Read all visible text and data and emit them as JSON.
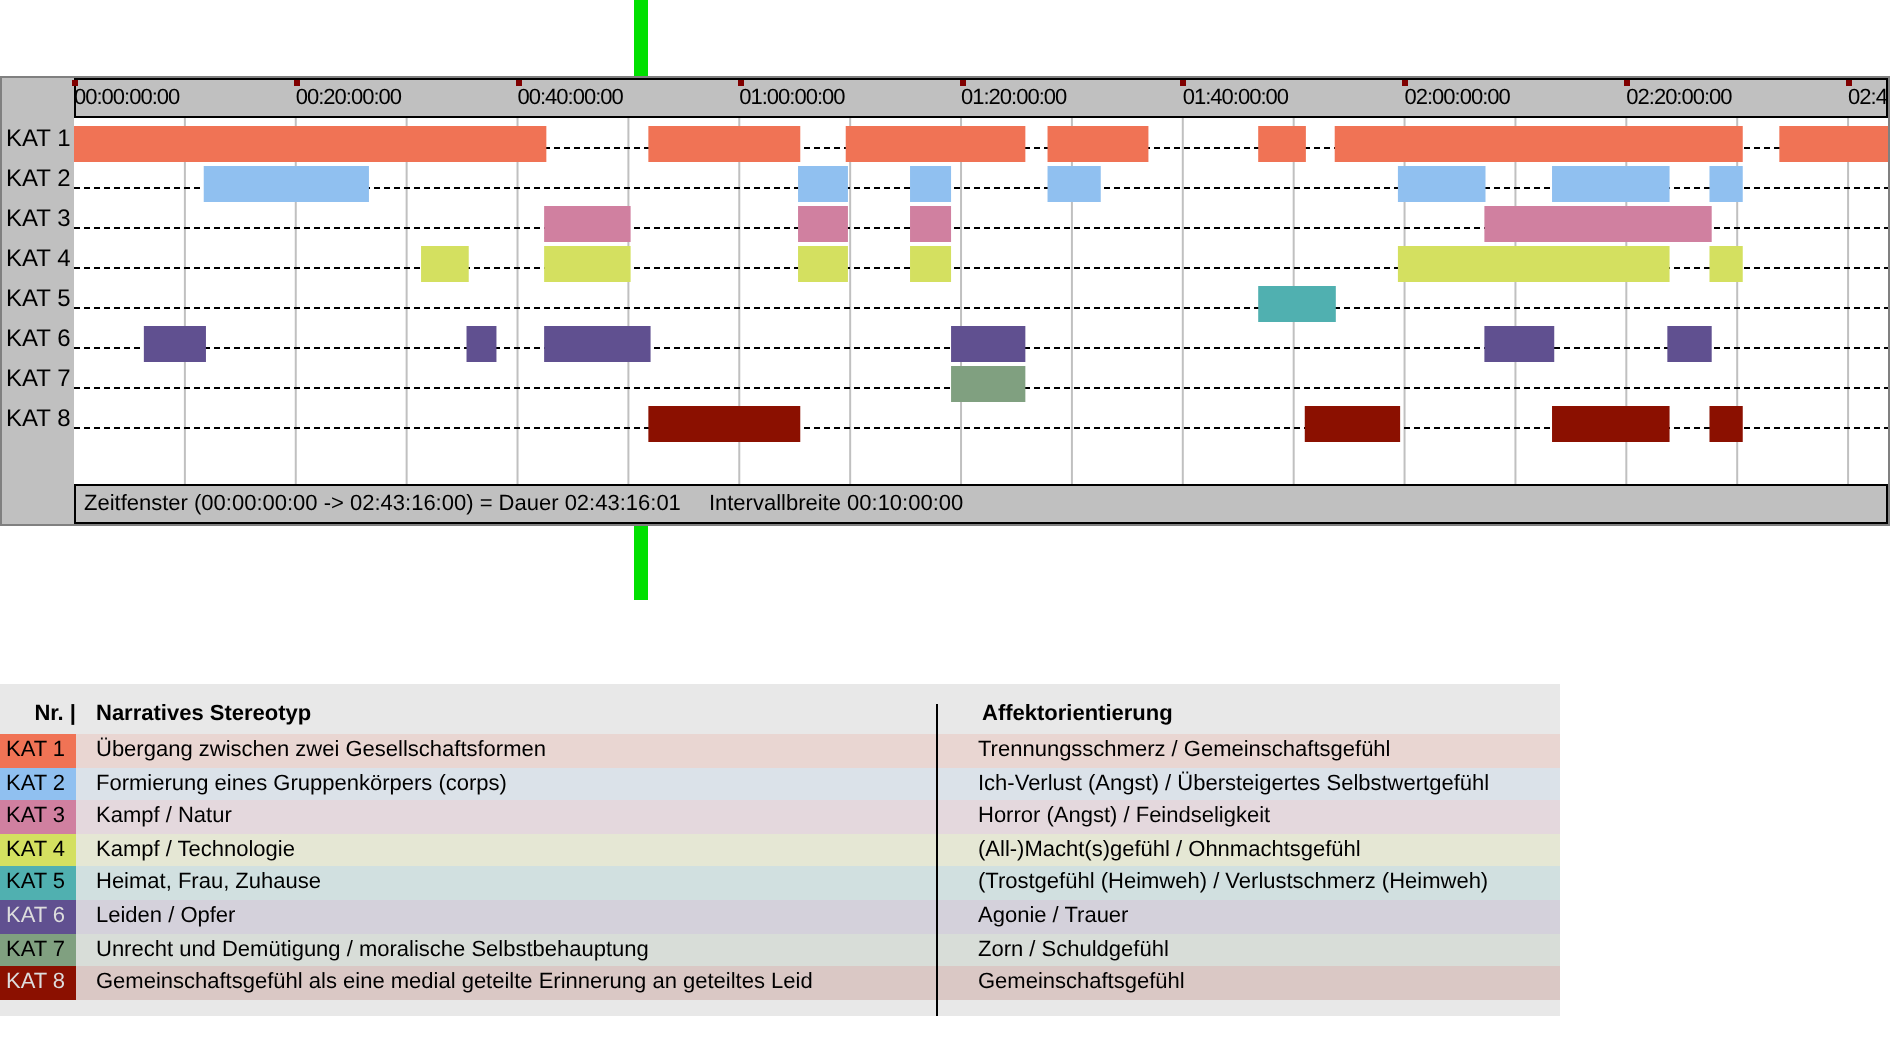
{
  "timeline": {
    "ruler": [
      "00:00:00:00",
      "00:20:00:00",
      "00:40:00:00",
      "01:00:00:00",
      "01:20:00:00",
      "01:40:00:00",
      "02:00:00:00",
      "02:20:00:00",
      "02:4"
    ],
    "tracks": [
      {
        "label": "KAT 1",
        "color": "#f07355"
      },
      {
        "label": "KAT 2",
        "color": "#90c0f0"
      },
      {
        "label": "KAT 3",
        "color": "#d080a0"
      },
      {
        "label": "KAT 4",
        "color": "#d4e060"
      },
      {
        "label": "KAT 5",
        "color": "#50b0b0"
      },
      {
        "label": "KAT 6",
        "color": "#605090"
      },
      {
        "label": "KAT 7",
        "color": "#80a080"
      },
      {
        "label": "KAT 8",
        "color": "#8b1000"
      }
    ],
    "status_bar": {
      "window": "Zeitfenster (00:00:00:00 -> 02:43:16:00) = Dauer 02:43:16:01",
      "interval": "Intervallbreite 00:10:00:00"
    }
  },
  "legend": {
    "columns": [
      "Nr. |",
      "Narratives Stereotyp",
      "Affektorientierung"
    ],
    "rows": [
      {
        "label": "KAT 1",
        "color": "#f07355",
        "stereotype": "Übergang zwischen zwei Gesellschaftsformen",
        "affect": "Trennungsschmerz / Gemeinschaftsgefühl"
      },
      {
        "label": "KAT 2",
        "color": "#90c0f0",
        "stereotype": "Formierung eines Gruppenkörpers (corps)",
        "affect": "Ich-Verlust (Angst) / Übersteigertes Selbstwertgefühl"
      },
      {
        "label": "KAT 3",
        "color": "#d080a0",
        "stereotype": "Kampf / Natur",
        "affect": "Horror (Angst) / Feindseligkeit"
      },
      {
        "label": "KAT 4",
        "color": "#d4e060",
        "stereotype": "Kampf / Technologie",
        "affect": "(All-)Macht(s)gefühl / Ohnmachtsgefühl"
      },
      {
        "label": "KAT 5",
        "color": "#50b0b0",
        "stereotype": "Heimat, Frau, Zuhause",
        "affect": "(Trostgefühl (Heimweh) / Verlustschmerz (Heimweh)"
      },
      {
        "label": "KAT 6",
        "color": "#605090",
        "stereotype": "Leiden / Opfer",
        "affect": "Agonie / Trauer"
      },
      {
        "label": "KAT 7",
        "color": "#80a080",
        "stereotype": "Unrecht und Demütigung / moralische Selbstbehauptung",
        "affect": "Zorn / Schuldgefühl"
      },
      {
        "label": "KAT 8",
        "color": "#8b1000",
        "stereotype": "Gemeinschaftsgefühl als eine medial geteilte Erinnerung an geteiltes Leid",
        "affect": "Gemeinschaftsgefühl"
      }
    ]
  }
}
